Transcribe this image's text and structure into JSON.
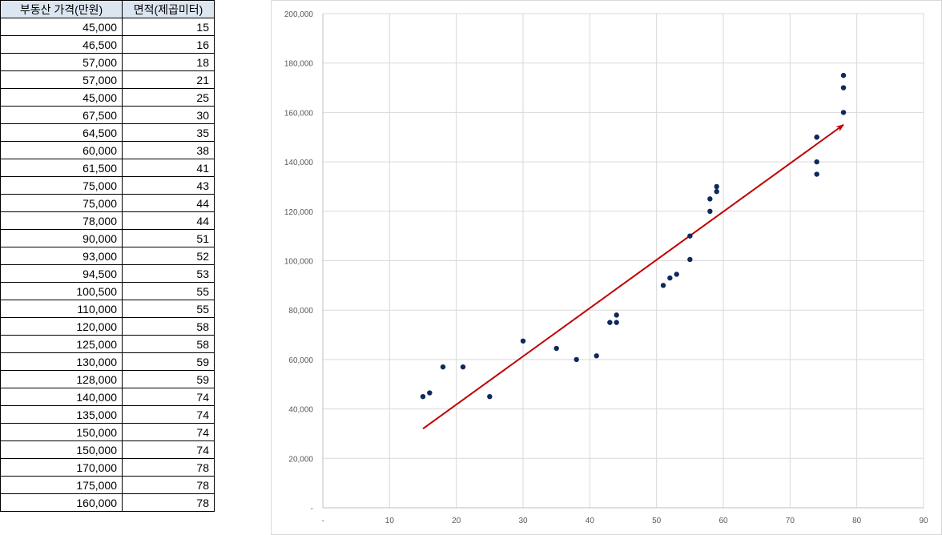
{
  "table": {
    "headers": [
      "부동산 가격(만원)",
      "면적(제곱미터)"
    ],
    "rows": [
      [
        "45,000",
        "15"
      ],
      [
        "46,500",
        "16"
      ],
      [
        "57,000",
        "18"
      ],
      [
        "57,000",
        "21"
      ],
      [
        "45,000",
        "25"
      ],
      [
        "67,500",
        "30"
      ],
      [
        "64,500",
        "35"
      ],
      [
        "60,000",
        "38"
      ],
      [
        "61,500",
        "41"
      ],
      [
        "75,000",
        "43"
      ],
      [
        "75,000",
        "44"
      ],
      [
        "78,000",
        "44"
      ],
      [
        "90,000",
        "51"
      ],
      [
        "93,000",
        "52"
      ],
      [
        "94,500",
        "53"
      ],
      [
        "100,500",
        "55"
      ],
      [
        "110,000",
        "55"
      ],
      [
        "120,000",
        "58"
      ],
      [
        "125,000",
        "58"
      ],
      [
        "130,000",
        "59"
      ],
      [
        "128,000",
        "59"
      ],
      [
        "140,000",
        "74"
      ],
      [
        "135,000",
        "74"
      ],
      [
        "150,000",
        "74"
      ],
      [
        "150,000",
        "74"
      ],
      [
        "170,000",
        "78"
      ],
      [
        "175,000",
        "78"
      ],
      [
        "160,000",
        "78"
      ]
    ]
  },
  "chart_data": {
    "type": "scatter",
    "title": "",
    "xlabel": "",
    "ylabel": "",
    "xlim": [
      0,
      90
    ],
    "ylim": [
      0,
      200000
    ],
    "x_ticks": [
      "-",
      "10",
      "20",
      "30",
      "40",
      "50",
      "60",
      "70",
      "80",
      "90"
    ],
    "y_ticks": [
      "-",
      "20,000",
      "40,000",
      "60,000",
      "80,000",
      "100,000",
      "120,000",
      "140,000",
      "160,000",
      "180,000",
      "200,000"
    ],
    "grid": true,
    "series": [
      {
        "color": "#0d2a5c",
        "points": [
          [
            15,
            45000
          ],
          [
            16,
            46500
          ],
          [
            18,
            57000
          ],
          [
            21,
            57000
          ],
          [
            25,
            45000
          ],
          [
            30,
            67500
          ],
          [
            35,
            64500
          ],
          [
            38,
            60000
          ],
          [
            41,
            61500
          ],
          [
            43,
            75000
          ],
          [
            44,
            75000
          ],
          [
            44,
            78000
          ],
          [
            51,
            90000
          ],
          [
            52,
            93000
          ],
          [
            53,
            94500
          ],
          [
            55,
            100500
          ],
          [
            55,
            110000
          ],
          [
            58,
            120000
          ],
          [
            58,
            125000
          ],
          [
            59,
            130000
          ],
          [
            59,
            128000
          ],
          [
            74,
            140000
          ],
          [
            74,
            135000
          ],
          [
            74,
            150000
          ],
          [
            74,
            150000
          ],
          [
            78,
            170000
          ],
          [
            78,
            175000
          ],
          [
            78,
            160000
          ]
        ]
      }
    ],
    "annotation_arrow": {
      "color": "#c00000",
      "from": [
        15,
        32000
      ],
      "to": [
        78,
        155000
      ]
    }
  }
}
